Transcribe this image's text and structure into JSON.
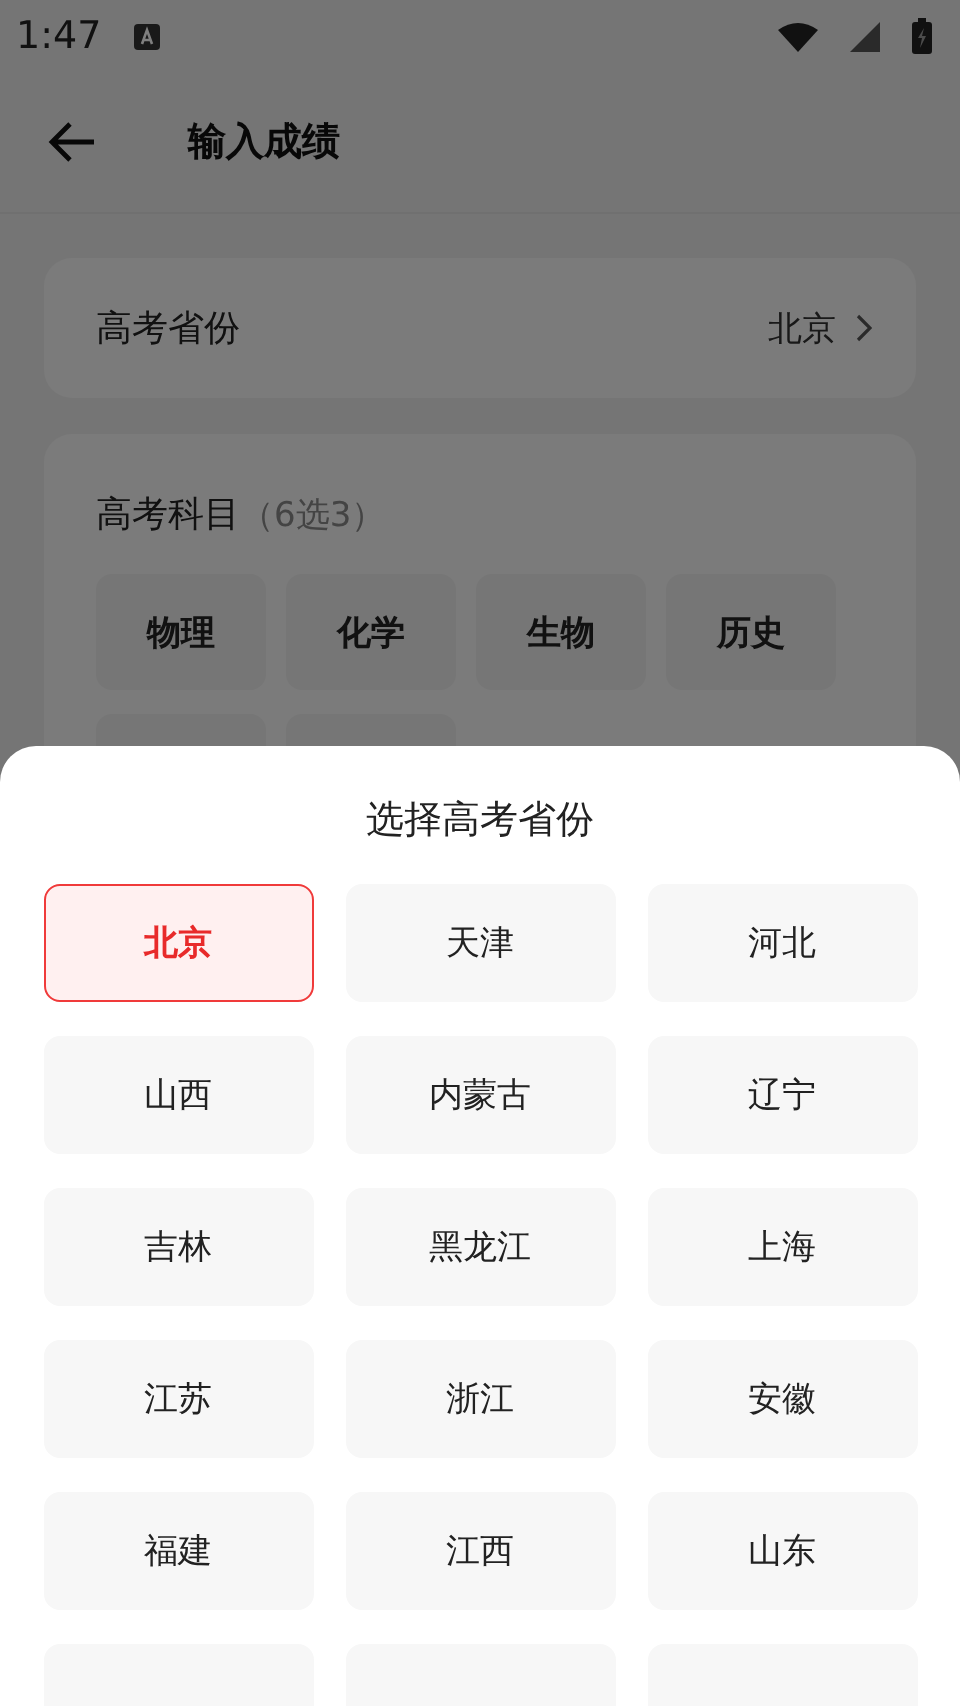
{
  "status_bar": {
    "time": "1:47"
  },
  "app_bar": {
    "title": "输入成绩"
  },
  "province_row": {
    "label": "高考省份",
    "value": "北京"
  },
  "subjects": {
    "title": "高考科目",
    "hint": "（6选3）",
    "options": [
      {
        "label": "物理"
      },
      {
        "label": "化学"
      },
      {
        "label": "生物"
      },
      {
        "label": "历史"
      }
    ]
  },
  "sheet": {
    "title": "选择高考省份",
    "provinces": [
      {
        "label": "北京",
        "selected": true
      },
      {
        "label": "天津",
        "selected": false
      },
      {
        "label": "河北",
        "selected": false
      },
      {
        "label": "山西",
        "selected": false
      },
      {
        "label": "内蒙古",
        "selected": false
      },
      {
        "label": "辽宁",
        "selected": false
      },
      {
        "label": "吉林",
        "selected": false
      },
      {
        "label": "黑龙江",
        "selected": false
      },
      {
        "label": "上海",
        "selected": false
      },
      {
        "label": "江苏",
        "selected": false
      },
      {
        "label": "浙江",
        "selected": false
      },
      {
        "label": "安徽",
        "selected": false
      },
      {
        "label": "福建",
        "selected": false
      },
      {
        "label": "江西",
        "selected": false
      },
      {
        "label": "山东",
        "selected": false
      }
    ]
  }
}
